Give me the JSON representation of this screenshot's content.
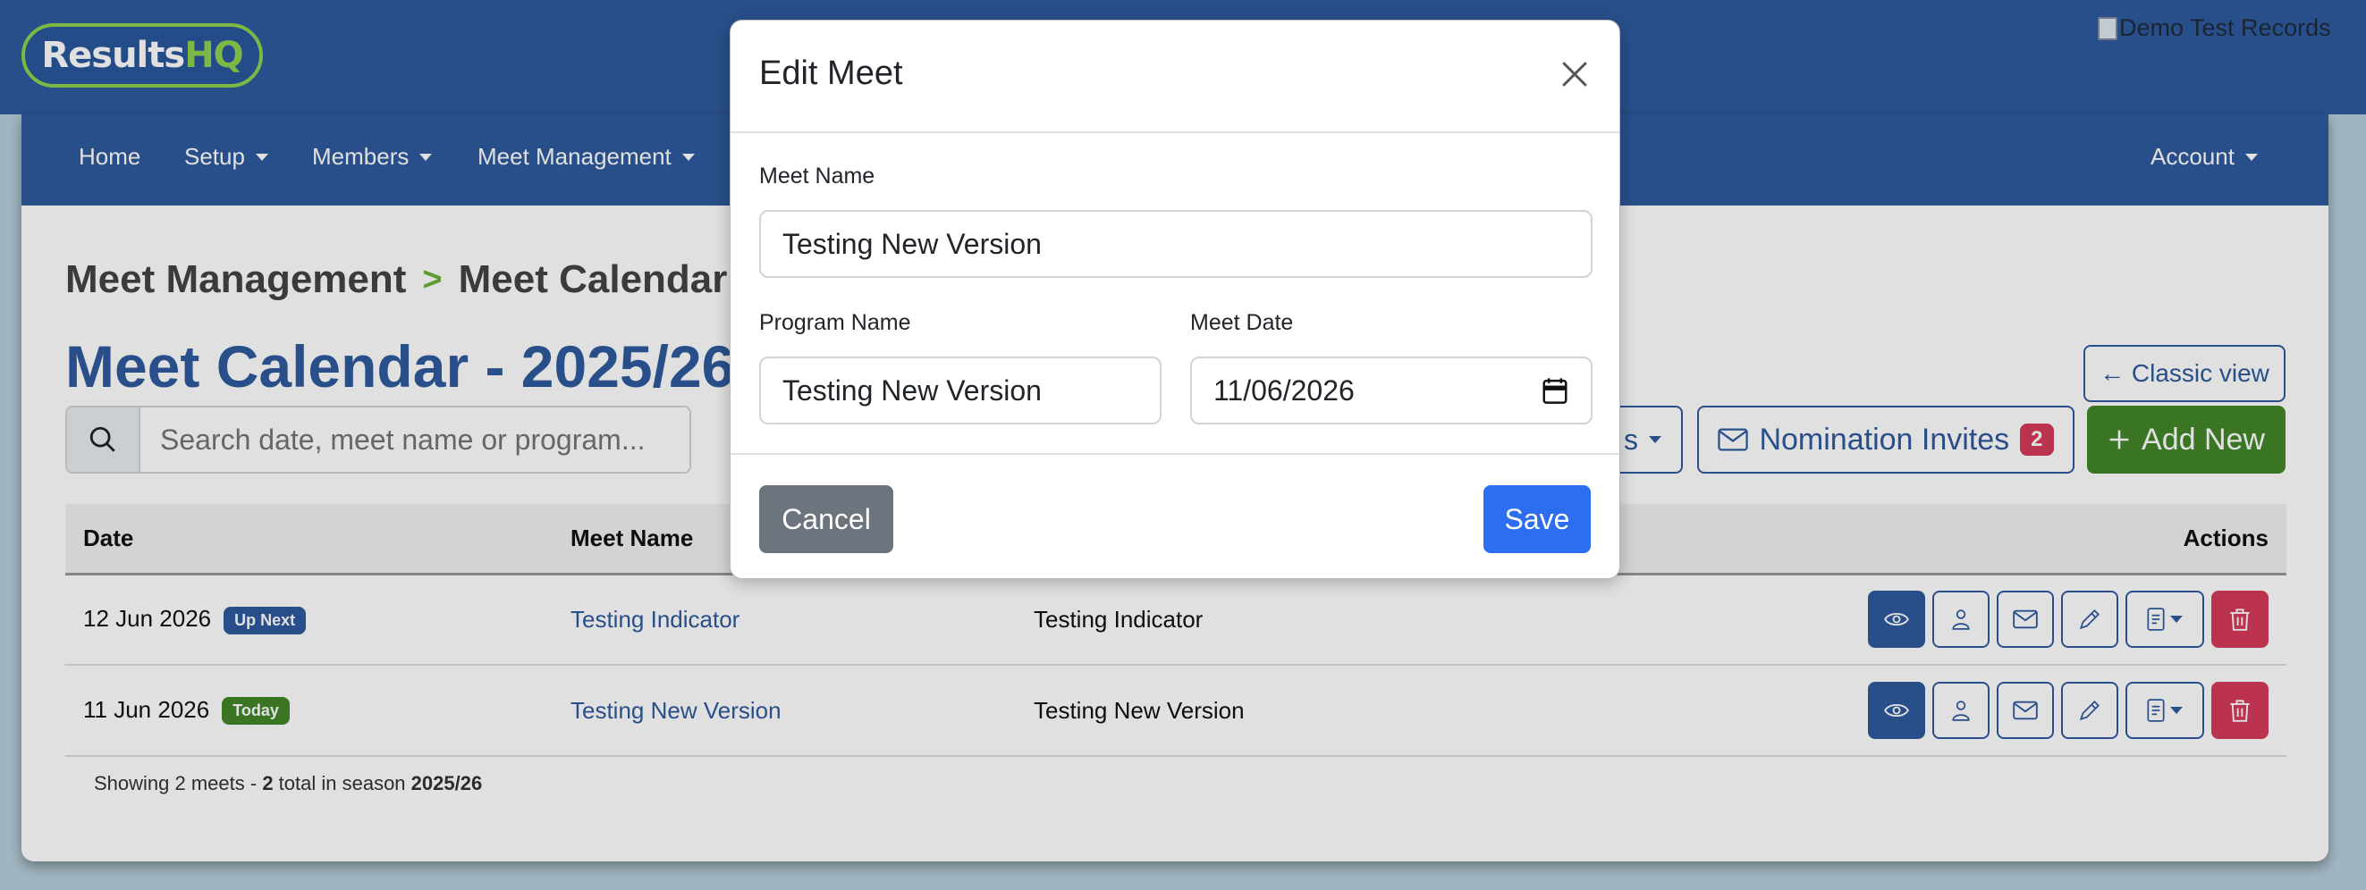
{
  "header": {
    "logo_part1": "Results",
    "logo_part2": "HQ",
    "demo_image_alt": "Demo Test Records"
  },
  "nav": {
    "items": [
      {
        "label": "Home",
        "dropdown": false
      },
      {
        "label": "Setup",
        "dropdown": true
      },
      {
        "label": "Members",
        "dropdown": true
      },
      {
        "label": "Meet Management",
        "dropdown": true
      }
    ],
    "account_label": "Account"
  },
  "breadcrumb": {
    "parent": "Meet Management",
    "separator": ">",
    "current": "Meet Calendar"
  },
  "page_title": "Meet Calendar - 2025/26",
  "search": {
    "placeholder": "Search date, meet name or program..."
  },
  "toolbar": {
    "classic_view_label": "← Classic view",
    "partial_button_label": "s",
    "nomination_invites_label": "Nomination Invites",
    "nomination_invites_count": "2",
    "add_new_label": "Add New"
  },
  "table": {
    "headers": [
      "Date",
      "Meet Name",
      "",
      "Actions"
    ],
    "rows": [
      {
        "date": "12 Jun 2026",
        "badge": "Up Next",
        "badge_color": "#2f5b9e",
        "meet_name": "Testing Indicator",
        "program": "Testing Indicator"
      },
      {
        "date": "11 Jun 2026",
        "badge": "Today",
        "badge_color": "#43862a",
        "meet_name": "Testing New Version",
        "program": "Testing New Version"
      }
    ]
  },
  "footer_note": {
    "prefix": "Showing 2 meets - ",
    "total": "2",
    "middle": " total in season ",
    "season": "2025/26"
  },
  "modal": {
    "title": "Edit Meet",
    "meet_name_label": "Meet Name",
    "meet_name_value": "Testing New Version",
    "program_name_label": "Program Name",
    "program_name_value": "Testing New Version",
    "meet_date_label": "Meet Date",
    "meet_date_value": "11/06/2026",
    "cancel_label": "Cancel",
    "save_label": "Save"
  },
  "colors": {
    "brand_blue": "#2f5b9e",
    "brand_green": "#43862a",
    "logo_green": "#8fd14f",
    "danger": "#d63b5a",
    "primary_save": "#2d6ef0",
    "secondary": "#6c757d"
  }
}
